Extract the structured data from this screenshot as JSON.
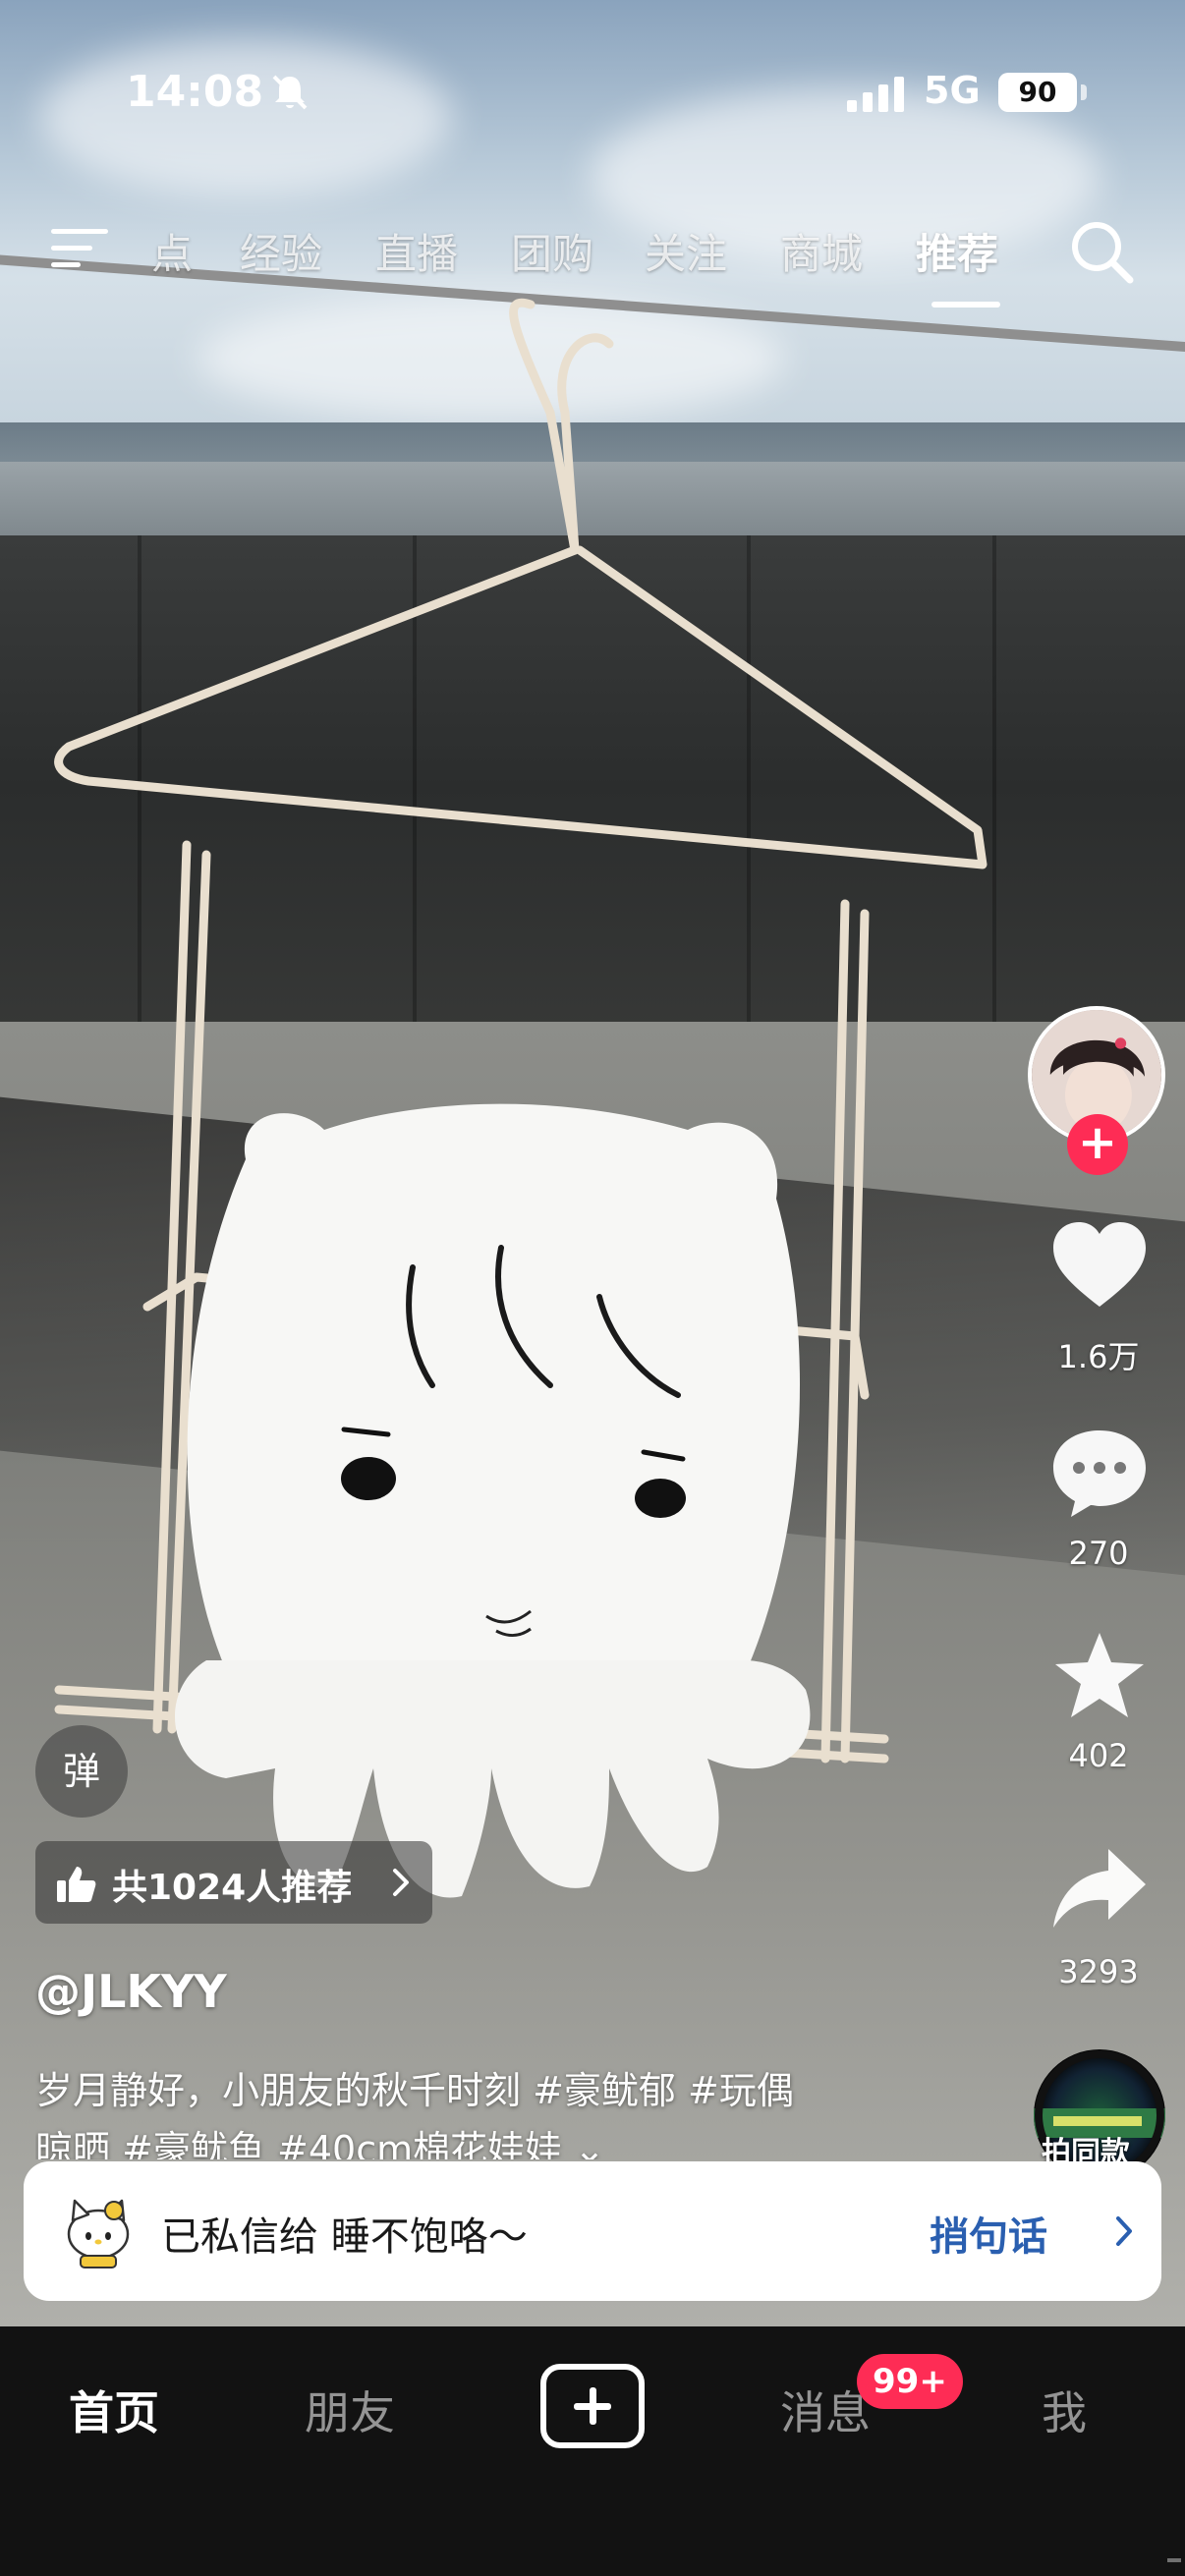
{
  "status_bar": {
    "time": "14:08",
    "network": "5G",
    "battery": "90"
  },
  "top_nav": {
    "tabs": [
      "点",
      "经验",
      "直播",
      "团购",
      "关注",
      "商城",
      "推荐"
    ],
    "active_tab": "推荐"
  },
  "video": {
    "author": "@JLKYY",
    "caption_line1": "岁月静好，小朋友的秋千时刻 #豪鱿郁 #玩偶",
    "caption_line2": "晾晒 #豪鱿鱼 #40cm棉花娃娃 ⌄",
    "recommend_text": "共1024人推荐",
    "danmu_label": "弹"
  },
  "actions": {
    "likes": "1.6万",
    "comments": "270",
    "favorites": "402",
    "shares": "3293",
    "music_label": "拍同款"
  },
  "toast": {
    "text": "已私信给 睡不饱咯～",
    "action": "捎句话"
  },
  "tab_bar": {
    "home": "首页",
    "friends": "朋友",
    "messages": "消息",
    "messages_badge": "99+",
    "me": "我"
  },
  "colors": {
    "accent": "#fe2c55",
    "toast_link": "#2a5fb0",
    "tab_bar_bg": "#121212"
  }
}
